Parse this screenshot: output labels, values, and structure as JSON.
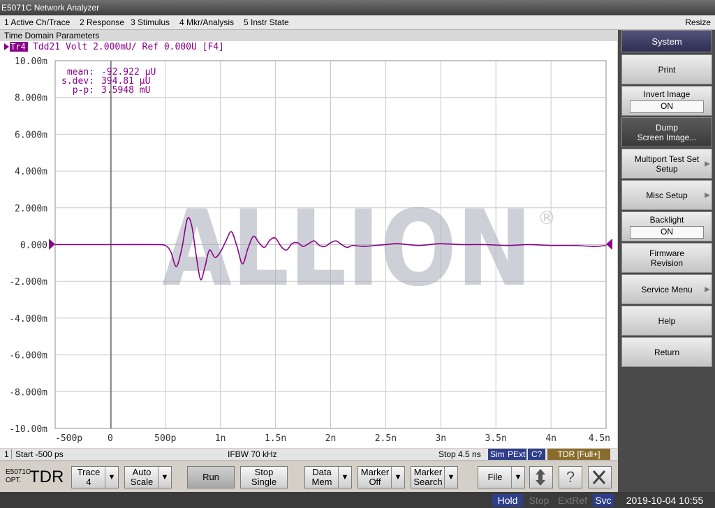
{
  "window": {
    "title": "E5071C Network Analyzer"
  },
  "menu": {
    "items": [
      "1 Active Ch/Trace",
      "2 Response",
      "3 Stimulus",
      "4 Mkr/Analysis",
      "5 Instr State"
    ],
    "resize": "Resize"
  },
  "panel": {
    "title": "Time Domain Parameters"
  },
  "trace_header": {
    "badge": "Tr4",
    "text": "Tdd21 Volt 2.000mU/ Ref 0.000U [F4]"
  },
  "stats": {
    "mean_label": "mean:",
    "mean_value": "-92.922 µU",
    "sdev_label": "s.dev:",
    "sdev_value": "394.81 µU",
    "pp_label": "p-p:",
    "pp_value": "3.5948 mU"
  },
  "watermark": {
    "text": "ALLION",
    "registered": "®"
  },
  "chart_data": {
    "type": "line",
    "title": "Tdd21 Volt 2.000mU/ Ref 0.000U [F4]",
    "xlabel": "",
    "ylabel": "",
    "xlim": [
      -0.5,
      4.5
    ],
    "ylim": [
      -10,
      10
    ],
    "grid": true,
    "ytick_labels": [
      "10.00m",
      "8.000m",
      "6.000m",
      "4.000m",
      "2.000m",
      "0.000",
      "-2.000m",
      "-4.000m",
      "-6.000m",
      "-8.000m",
      "-10.00m"
    ],
    "xtick_labels": [
      "-500p",
      "0",
      "500p",
      "1n",
      "1.5n",
      "2n",
      "2.5n",
      "3n",
      "3.5n",
      "4n",
      "4.5n"
    ],
    "series": [
      {
        "name": "Tdd21",
        "color": "#8b008b",
        "x": [
          -0.5,
          0.0,
          0.4,
          0.5,
          0.55,
          0.6,
          0.65,
          0.7,
          0.74,
          0.78,
          0.82,
          0.86,
          0.9,
          0.95,
          1.0,
          1.05,
          1.1,
          1.15,
          1.2,
          1.25,
          1.3,
          1.35,
          1.4,
          1.45,
          1.5,
          1.55,
          1.6,
          1.65,
          1.7,
          1.75,
          1.8,
          1.85,
          1.9,
          1.95,
          2.0,
          2.05,
          2.1,
          2.15,
          2.2,
          2.3,
          2.4,
          2.5,
          2.6,
          2.7,
          2.8,
          2.9,
          3.0,
          3.2,
          3.4,
          3.6,
          3.8,
          4.0,
          4.2,
          4.4,
          4.5
        ],
        "y": [
          0.0,
          0.0,
          0.0,
          -0.05,
          -0.4,
          -1.2,
          -0.2,
          1.4,
          1.0,
          -0.6,
          -1.9,
          -1.2,
          -0.3,
          -0.7,
          -0.4,
          0.2,
          0.7,
          -0.1,
          -1.05,
          -0.2,
          0.45,
          0.1,
          -0.15,
          0.25,
          0.35,
          -0.1,
          -0.3,
          0.05,
          0.1,
          -0.1,
          0.05,
          0.2,
          -0.05,
          -0.1,
          0.1,
          0.2,
          0.0,
          -0.15,
          -0.05,
          -0.1,
          -0.05,
          0.0,
          0.05,
          0.0,
          -0.05,
          0.0,
          0.05,
          0.0,
          0.0,
          -0.05,
          0.0,
          -0.05,
          -0.05,
          -0.1,
          -0.05
        ]
      }
    ]
  },
  "status": {
    "channel": "1",
    "start": "Start -500 ps",
    "ifbw": "IFBW 70 kHz",
    "stop": "Stop 4.5 ns",
    "sim": "Sim",
    "pext": "PExt",
    "cal": "C?",
    "tdr": "TDR [Full+]"
  },
  "softkeys": {
    "title": "System",
    "print": "Print",
    "invert_label": "Invert Image",
    "invert_value": "ON",
    "dump_line1": "Dump",
    "dump_line2": "Screen Image...",
    "multiport_line1": "Multiport Test Set",
    "multiport_line2": "Setup",
    "misc": "Misc Setup",
    "backlight_label": "Backlight",
    "backlight_value": "ON",
    "firmware_line1": "Firmware",
    "firmware_line2": "Revision",
    "service": "Service Menu",
    "help": "Help",
    "return": "Return"
  },
  "toolbar": {
    "model_line1": "E5071C",
    "model_line2": "OPT.",
    "mode": "TDR",
    "trace_line1": "Trace",
    "trace_line2": "4",
    "autoscale_line1": "Auto",
    "autoscale_line2": "Scale",
    "run": "Run",
    "stop_line1": "Stop",
    "stop_line2": "Single",
    "datamem_line1": "Data",
    "datamem_line2": "Mem",
    "marker_line1": "Marker",
    "marker_line2": "Off",
    "msearch_line1": "Marker",
    "msearch_line2": "Search",
    "file": "File",
    "help_glyph": "?"
  },
  "bottom": {
    "hold": "Hold",
    "stop": "Stop",
    "extref": "ExtRef",
    "svc": "Svc",
    "datetime": "2019-10-04 10:55"
  },
  "colors": {
    "trace": "#8b008b",
    "badge": "#8b008b",
    "grid": "#c8c8c8",
    "softkey_header": "#3a3a66",
    "hold": "#2f3e8a",
    "svc": "#2f3e8a",
    "tdr_badge": "#8a6d2c"
  }
}
